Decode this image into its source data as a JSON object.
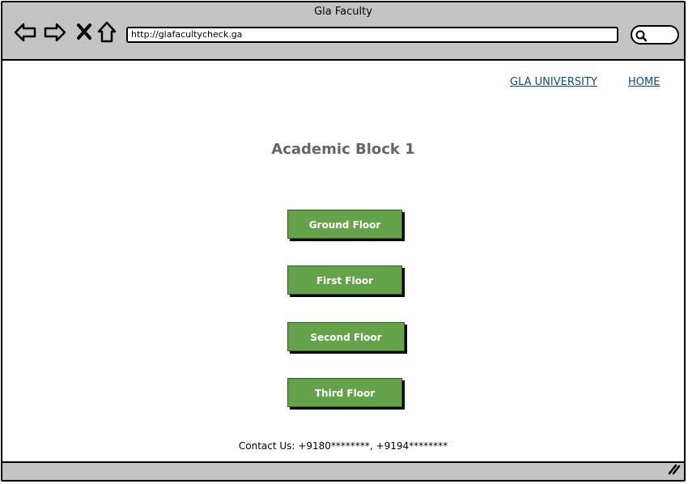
{
  "window": {
    "title": "Gla Faculty"
  },
  "browser": {
    "url": "http://glafacultycheck.ga",
    "icons": [
      "back-arrow-icon",
      "forward-arrow-icon",
      "close-x-icon",
      "home-icon",
      "search-icon",
      "resize-grip-icon"
    ]
  },
  "nav": {
    "university_link": "GLA UNIVERSITY",
    "home_link": "HOME"
  },
  "main": {
    "heading": "Academic Block 1",
    "floors": [
      "Ground Floor",
      "First Floor",
      "Second Floor",
      "Third Floor"
    ]
  },
  "footer": {
    "contact": "Contact Us: +9180********, +9194********"
  },
  "colors": {
    "button_green": "#64a34a",
    "link_blue": "#0b4a8b",
    "chrome_gray": "#c4c4c4",
    "heading_gray": "#666666"
  }
}
